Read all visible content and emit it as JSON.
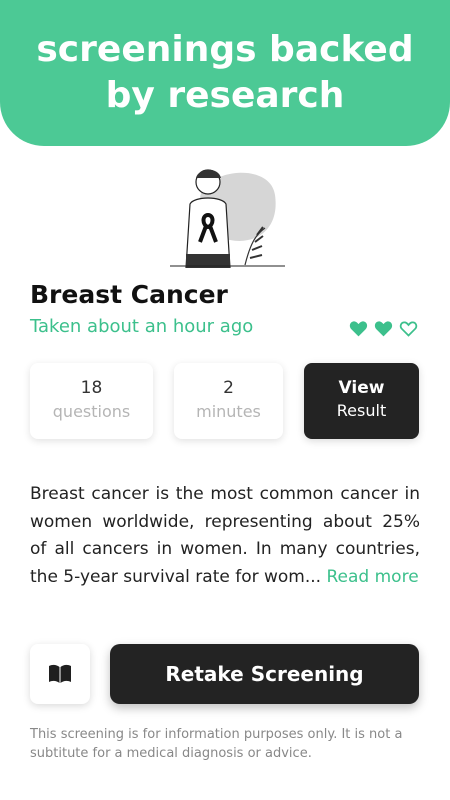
{
  "banner": {
    "text": "screenings backed by research"
  },
  "test": {
    "title": "Breast Cancer",
    "taken": "Taken about an hour ago",
    "rating": 2,
    "rating_max": 3,
    "accent_color": "#3cc08c"
  },
  "stats": {
    "questions_count": "18",
    "questions_label": "questions",
    "minutes_count": "2",
    "minutes_label": "minutes"
  },
  "view_result": {
    "line1": "View",
    "line2": "Result"
  },
  "description": {
    "text": "Breast cancer is the most common cancer in women worldwide, representing about 25% of all cancers in women. In many countries, the 5-year survival rate for wom...",
    "read_more": "Read more"
  },
  "actions": {
    "book_icon": "book-icon",
    "retake_label": "Retake Screening"
  },
  "disclaimer": "This screening is for information purposes only. It is not a subtitute for a medical diagnosis or advice."
}
